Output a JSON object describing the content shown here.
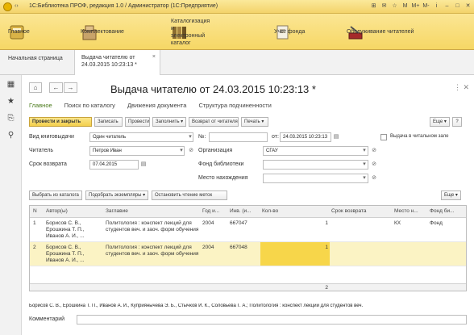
{
  "window": {
    "title": "1С:Библиотека ПРОФ, редакция 1.0 / Администратор (1С:Предприятие)",
    "buttons": [
      "⊞",
      "✉",
      "☆",
      "M",
      "M+",
      "M-",
      "i",
      "–",
      "□",
      "✕"
    ]
  },
  "sections": [
    {
      "label": "Главное",
      "icon": "home-panel-icon",
      "color": "#c9a53c"
    },
    {
      "label": "Комплектование",
      "icon": "boxes-icon",
      "color": "#b0894b"
    },
    {
      "label": "Каталогизация и\nэлектронный каталог",
      "icon": "catalog-cards-icon",
      "color": "#8a6c2e"
    },
    {
      "label": "Учет фонда",
      "icon": "documents-icon",
      "color": "#9a8660"
    },
    {
      "label": "Обслуживание читателей",
      "icon": "tools-icon",
      "color": "#7b6a5a"
    }
  ],
  "tabs": {
    "home": "Начальная страница",
    "active_line1": "Выдача читателю  от",
    "active_line2": "24.03.2015 10:23:13 *",
    "close": "×"
  },
  "form": {
    "title": "Выдача читателю  от 24.03.2015 10:23:13 *",
    "subtabs": [
      "Главное",
      "Поиск по каталогу",
      "Движения документа",
      "Структура подчиненности"
    ],
    "toolbar": {
      "post_close": "Провести и закрыть",
      "write": "Записать",
      "post": "Провести",
      "fill": "Заполнить ▾",
      "return": "Возврат от читателя",
      "print": "Печать ▾",
      "more": "Еще ▾",
      "help": "?"
    },
    "fields": {
      "issue_type_label": "Вид книговыдачи",
      "issue_type_value": "Один читатель",
      "number_label": "№:",
      "number_value": "",
      "date_label": "от:",
      "date_value": "24.03.2015 10:23:13",
      "reading_room_label": "Выдача в читальном зале",
      "reader_label": "Читатель",
      "reader_value": "Петров Иван",
      "org_label": "Организация",
      "org_value": "СГАУ",
      "return_label": "Срок возврата",
      "return_value": "07.04.2015",
      "fund_label": "Фонд библиотеки",
      "fund_value": "",
      "location_label": "Место нахождения",
      "location_value": ""
    },
    "table_toolbar": {
      "select_catalog": "Выбрать из каталога",
      "pick_copies": "Подобрать экземпляры ▾",
      "stop_reading": "Остановить чтение меток",
      "more": "Еще ▾"
    },
    "table": {
      "headers": [
        "N",
        "Автор(ы)",
        "Заглавие",
        "Год и...",
        "Инв. (и...",
        "Кол-во",
        "Срок возврата",
        "Место н...",
        "Фонд би..."
      ],
      "rows": [
        {
          "n": "1",
          "authors": "Борисов С. В., Ерошкина Т. П., Иванов А. И., ...",
          "title": "Политология : конспект лекций для студентов веч. и заоч. форм обучения",
          "year": "2004",
          "inv": "667047",
          "qty": "1",
          "return": "",
          "place": "КХ",
          "fund": "Фонд"
        },
        {
          "n": "2",
          "authors": "Борисов С. В., Ерошкина Т. П., Иванов А. И., ...",
          "title": "Политология : конспект лекций для студентов веч. и заоч. форм обучения",
          "year": "2004",
          "inv": "667048",
          "qty": "1",
          "return": "",
          "place": "",
          "fund": ""
        }
      ],
      "total_qty": "2"
    },
    "bottom_text": "Борисов С. В., Ерошкина Т. П., Иванов А. И., Куприянычева Э. Б., Стычков И. К., Соловьева Г. А.; Политология : конспект лекций для студентов веч.",
    "comment_label": "Комментарий",
    "comment_value": ""
  },
  "colors": {
    "accent_yellow": "#f3cf4c",
    "selected_row": "#fbf3c4",
    "selected_cell": "#f7d64a",
    "active_subtab": "#4a7a1a"
  }
}
